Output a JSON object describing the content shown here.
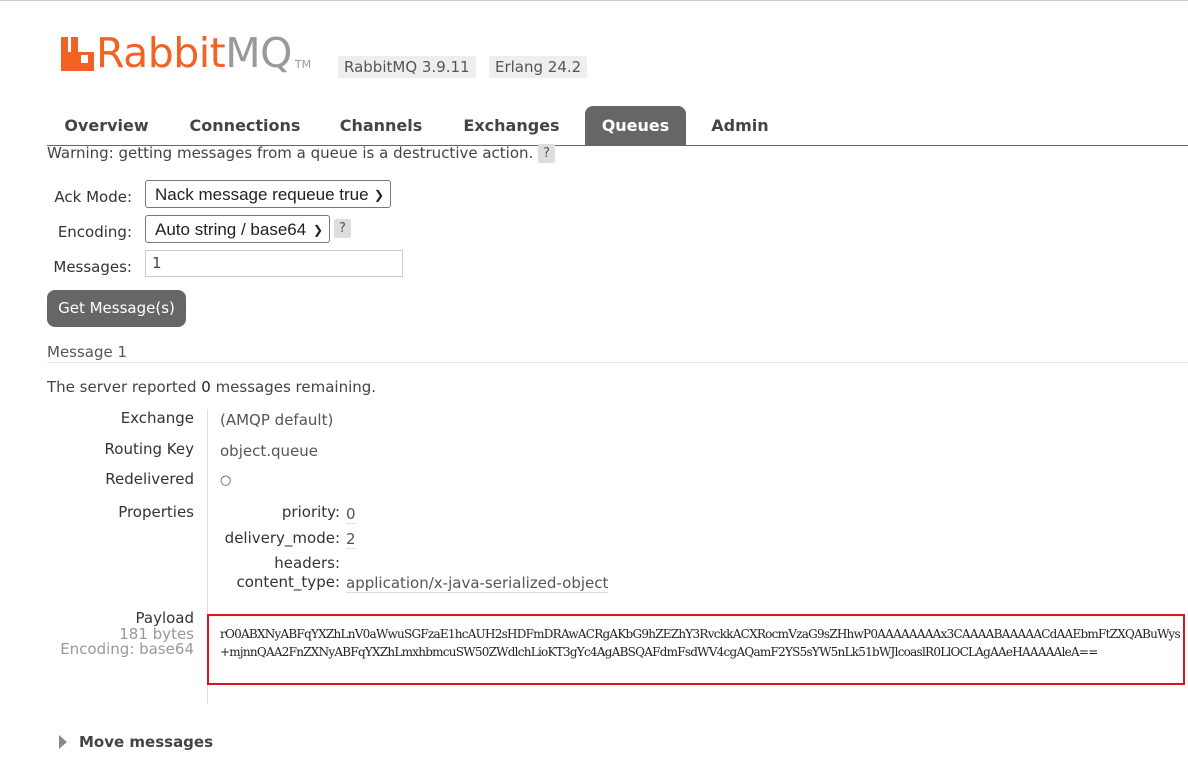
{
  "header": {
    "logo_rabbit": "Rabbit",
    "logo_mq": "MQ",
    "logo_tm": "TM",
    "version": "RabbitMQ 3.9.11",
    "erlang": "Erlang 24.2"
  },
  "tabs": [
    "Overview",
    "Connections",
    "Channels",
    "Exchanges",
    "Queues",
    "Admin"
  ],
  "active_tab": "Queues",
  "warning": "Warning: getting messages from a queue is a destructive action.",
  "help_mark": "?",
  "form": {
    "ack_label": "Ack Mode:",
    "ack_value": "Nack message requeue true",
    "encoding_label": "Encoding:",
    "encoding_value": "Auto string / base64",
    "messages_label": "Messages:",
    "messages_value": "1",
    "get_button": "Get Message(s)"
  },
  "message": {
    "title": "Message 1",
    "remaining_prefix": "The server reported ",
    "remaining_count": "0",
    "remaining_suffix": " messages remaining.",
    "exchange_label": "Exchange",
    "exchange_value": "(AMQP default)",
    "routing_key_label": "Routing Key",
    "routing_key_value": "object.queue",
    "redelivered_label": "Redelivered",
    "redelivered_value": "○",
    "properties_label": "Properties",
    "properties": {
      "priority_label": "priority:",
      "priority_value": "0",
      "delivery_mode_label": "delivery_mode:",
      "delivery_mode_value": "2",
      "headers_label": "headers:",
      "content_type_label": "content_type:",
      "content_type_value": "application/x-java-serialized-object"
    },
    "payload_label": "Payload",
    "payload_size": "181 bytes",
    "payload_encoding": "Encoding: base64",
    "payload": "rO0ABXNyABFqYXZhLnV0aWwuSGFzaE1hcAUH2sHDFmDRAwACRgAKbG9hZEZhY3RvckkACXRocmVzaG9sZHhwP0AAAAAAAAx3CAAAABAAAAACdAAEbmFtZXQABuWys+mjnnQAA2FnZXNyABFqYXZhLmxhbmcuSW50ZWdlchLioKT3gYc4AgABSQAFdmFsdWV4cgAQamF2YS5sYW5nLk51bWJlcoaslR0LlOCLAgAAeHAAAAAleA=="
  },
  "move_messages": "Move messages"
}
